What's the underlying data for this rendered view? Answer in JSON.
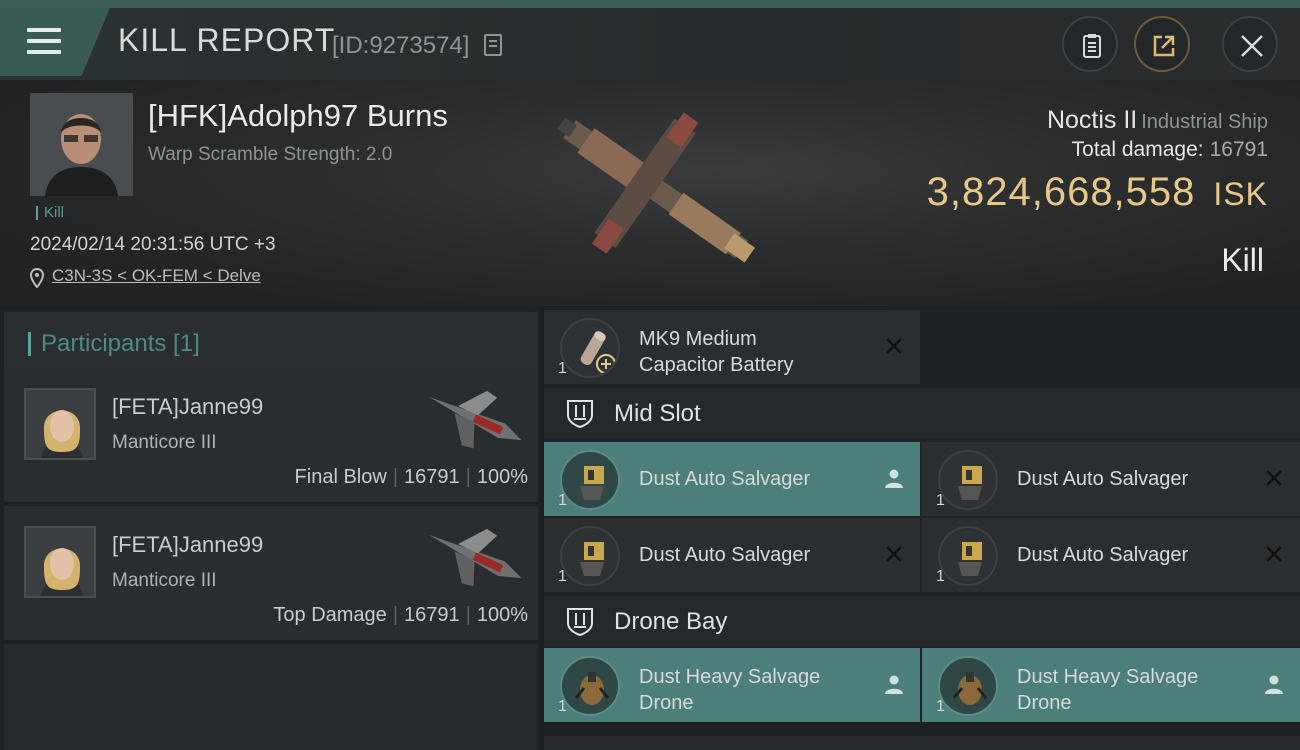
{
  "header": {
    "title": "KILL REPORT",
    "id_label": "[ID:9273574]",
    "buttons": [
      "clipboard-icon",
      "share-icon",
      "close-icon"
    ]
  },
  "victim": {
    "name": "[HFK]Adolph97 Burns",
    "warp_scramble": "Warp Scramble Strength: 2.0",
    "tag": "Kill",
    "datetime": "2024/02/14 20:31:56 UTC +3",
    "location": "C3N-3S < OK-FEM < Delve"
  },
  "ship": {
    "name": "Noctis II",
    "class": "Industrial Ship",
    "total_damage_label": "Total damage:",
    "total_damage": "16791",
    "isk_value": "3,824,668,558",
    "isk_unit": "ISK",
    "result": "Kill"
  },
  "participants": {
    "title": "Participants [1]",
    "rows": [
      {
        "name": "[FETA]Janne99",
        "ship": "Manticore III",
        "role": "Final Blow",
        "damage": "16791",
        "percent": "100%"
      },
      {
        "name": "[FETA]Janne99",
        "ship": "Manticore III",
        "role": "Top Damage",
        "damage": "16791",
        "percent": "100%"
      }
    ]
  },
  "fitting": {
    "top_item": {
      "qty": "1",
      "name_line1": "MK9 Medium",
      "name_line2": "Capacitor Battery",
      "status": "destroyed"
    },
    "mid_slot": {
      "title": "Mid Slot",
      "items": [
        {
          "qty": "1",
          "name": "Dust Auto Salvager",
          "status": "dropped"
        },
        {
          "qty": "1",
          "name": "Dust Auto Salvager",
          "status": "destroyed"
        },
        {
          "qty": "1",
          "name": "Dust Auto Salvager",
          "status": "destroyed"
        },
        {
          "qty": "1",
          "name": "Dust Auto Salvager",
          "status": "destroyed"
        }
      ]
    },
    "drone_bay": {
      "title": "Drone Bay",
      "items": [
        {
          "qty": "1",
          "name_line1": "Dust Heavy Salvage",
          "name_line2": "Drone",
          "status": "dropped"
        },
        {
          "qty": "1",
          "name_line1": "Dust Heavy Salvage",
          "name_line2": "Drone",
          "status": "dropped"
        }
      ]
    }
  },
  "colors": {
    "accent_teal": "#4c7f79",
    "isk_gold": "#e8c886",
    "header_teal": "#3a5a56"
  }
}
